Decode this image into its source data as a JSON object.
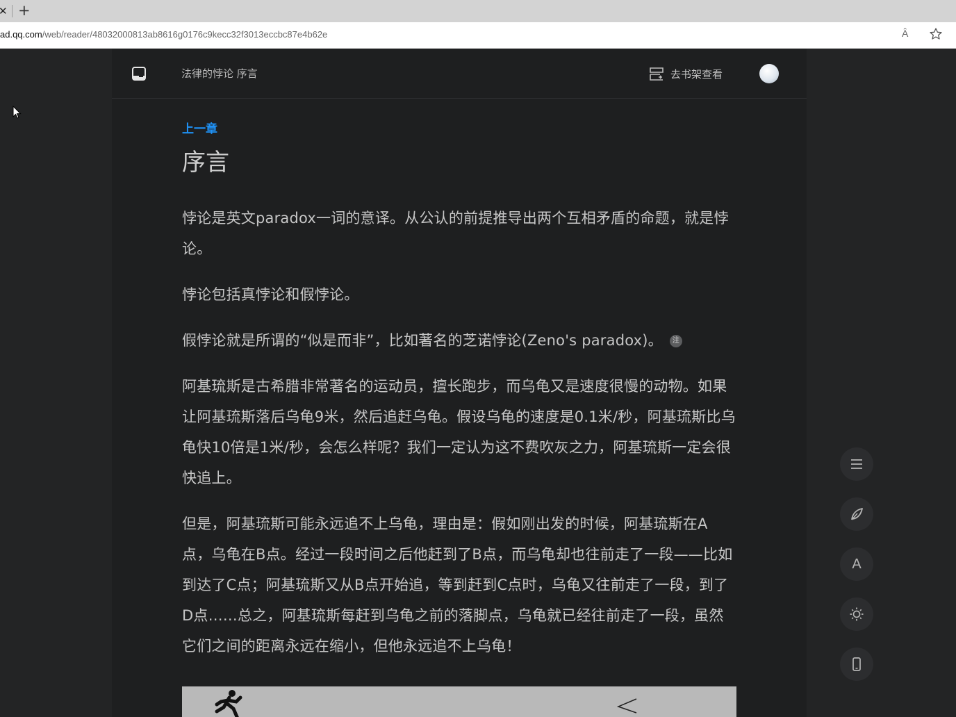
{
  "browser": {
    "url_host": "ad.qq.com",
    "url_path": "/web/reader/48032000813ab8616g0176c9kecc32f3013eccbc87e4b62e",
    "close_glyph": "✕",
    "new_tab_glyph": "+",
    "read_aloud_label": "Ȃ"
  },
  "reader": {
    "book_title": "法律的悖论 序言",
    "shelf_label": "去书架查看",
    "prev_chapter": "上一章",
    "chapter_title": "序言",
    "note_label": "注",
    "paragraphs": [
      "悖论是英文paradox一词的意译。从公认的前提推导出两个互相矛盾的命题，就是悖论。",
      "悖论包括真悖论和假悖论。",
      "假悖论就是所谓的“似是而非”，比如著名的芝诺悖论(Zeno's paradox)。",
      "阿基琉斯是古希腊非常著名的运动员，擅长跑步，而乌龟又是速度很慢的动物。如果让阿基琉斯落后乌龟9米，然后追赶乌龟。假设乌龟的速度是0.1米/秒，阿基琉斯比乌龟快10倍是1米/秒，会怎么样呢？我们一定认为这不费吹灰之力，阿基琉斯一定会很快追上。",
      "但是，阿基琉斯可能永远追不上乌龟，理由是：假如刚出发的时候，阿基琉斯在A点，乌龟在B点。经过一段时间之后他赶到了B点，而乌龟却也往前走了一段——比如到达了C点；阿基琉斯又从B点开始追，等到赶到C点时，乌龟又往前走了一段，到了D点……总之，阿基琉斯每赶到乌龟之前的落脚点，乌龟就已经往前走了一段，虽然它们之间的距离永远在缩小，但他永远追不上乌龟！"
    ],
    "font_button_label": "A"
  },
  "colors": {
    "page_bg": "#232425",
    "reader_bg": "#1e1f20",
    "link": "#1f91f5",
    "text": "#c6c6c6"
  },
  "icons": [
    "close-icon",
    "new-tab-icon",
    "read-aloud-icon",
    "favorite-star-icon",
    "logo-icon",
    "bookshelf-icon",
    "menu-icon",
    "pen-icon",
    "font-icon",
    "brightness-icon",
    "phone-icon",
    "cursor-icon"
  ]
}
